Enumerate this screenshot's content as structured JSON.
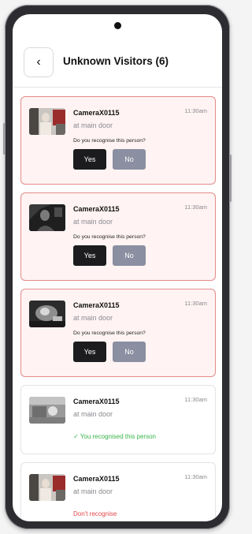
{
  "header": {
    "back_icon": "chevron-left-icon",
    "back_glyph": "‹",
    "title": "Unknown Visitors (6)"
  },
  "alerts": [
    {
      "camera": "CameraX0115",
      "time": "11:30am",
      "location": "at main door",
      "question": "Do you recognise this person?",
      "yes_label": "Yes",
      "no_label": "No"
    },
    {
      "camera": "CameraX0115",
      "time": "11:30am",
      "location": "at main door",
      "question": "Do you recognise this person?",
      "yes_label": "Yes",
      "no_label": "No"
    },
    {
      "camera": "CameraX0115",
      "time": "11:30am",
      "location": "at main door",
      "question": "Do you recognise this person?",
      "yes_label": "Yes",
      "no_label": "No"
    },
    {
      "camera": "CameraX0115",
      "time": "11:30am",
      "location": "at main door",
      "status": "✓ You recognised this person",
      "status_color": "#38b44a"
    },
    {
      "camera": "CameraX0115",
      "time": "11:30am",
      "location": "at main door",
      "status": "Don't recognise",
      "status_color": "#e04848"
    }
  ],
  "colors": {
    "alert_border": "#e58a8a",
    "alert_bg": "#fff3f3",
    "yes_button": "#1c1c1e",
    "no_button": "#8a8fa1"
  }
}
